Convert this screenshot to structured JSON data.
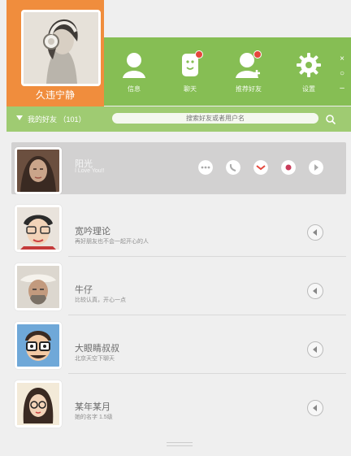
{
  "profile": {
    "name": "久违宁静"
  },
  "nav": [
    {
      "label": "信息"
    },
    {
      "label": "聊天"
    },
    {
      "label": "推荐好友"
    },
    {
      "label": "设置"
    }
  ],
  "window_controls": {
    "close": "×",
    "minimize": "–",
    "settings": "○"
  },
  "search": {
    "group_label": "我的好友 （101）",
    "placeholder": "搜索好友或者用户名"
  },
  "contacts": [
    {
      "name": "阳光",
      "status": "I Love You!!"
    },
    {
      "name": "宽吟理论",
      "status": "再好朋友也不会一起开心的人"
    },
    {
      "name": "牛仔",
      "status": "比较认真，开心一点"
    },
    {
      "name": "大眼睛叔叔",
      "status": "北京天空下聊天"
    },
    {
      "name": "某年某月",
      "status": "她的名字 1.5级"
    }
  ],
  "colors": {
    "orange": "#f08d3d",
    "green": "#86be54",
    "light_green": "#9fcb72"
  }
}
